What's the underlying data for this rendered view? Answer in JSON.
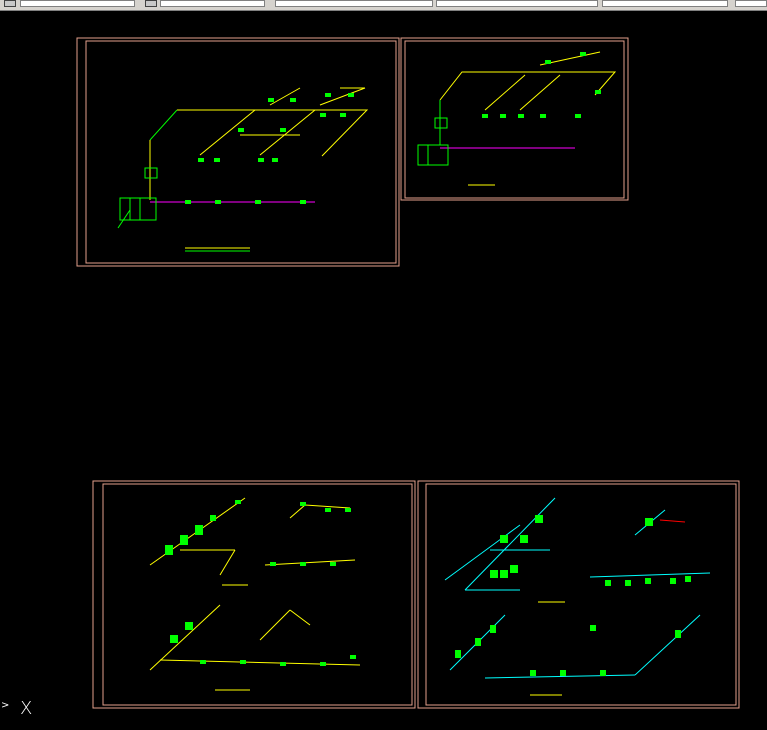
{
  "window": {
    "toolbar": {
      "segments": 6
    },
    "ucs": {
      "label": "X",
      "arrow": ">"
    }
  },
  "colors": {
    "background": "#000000",
    "frame": "#e3a08c",
    "pipe_yellow": "#ffff00",
    "pipe_green": "#00ff00",
    "pipe_magenta": "#ff00ff",
    "pipe_cyan": "#00ffff",
    "pipe_red": "#ff0000"
  },
  "sheets": [
    {
      "name": "sheet-top-left"
    },
    {
      "name": "sheet-top-right"
    },
    {
      "name": "sheet-bottom-left"
    },
    {
      "name": "sheet-bottom-right"
    }
  ]
}
